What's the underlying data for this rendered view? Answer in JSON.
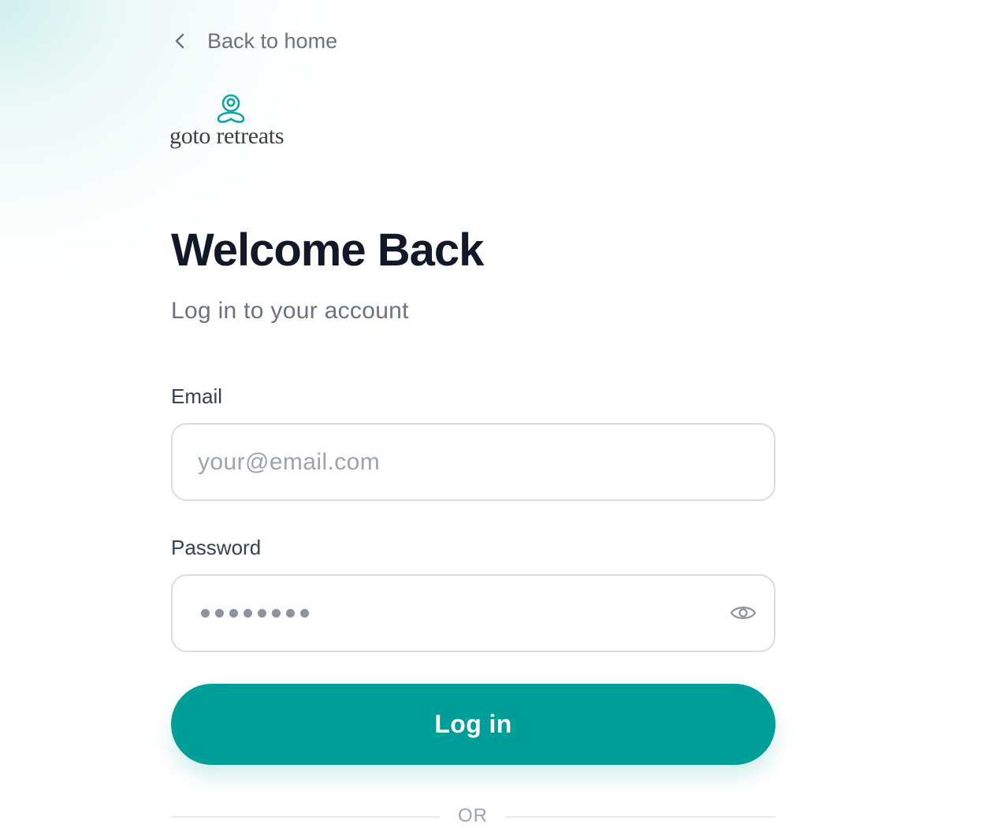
{
  "nav": {
    "back_label": "Back to home"
  },
  "brand": {
    "wordmark": "goto retreats",
    "accent_color": "#009e99"
  },
  "heading": {
    "title": "Welcome Back",
    "subtitle": "Log in to your account"
  },
  "form": {
    "email": {
      "label": "Email",
      "placeholder": "your@email.com",
      "value": ""
    },
    "password": {
      "label": "Password",
      "masked_length": 8,
      "visibility_icon": "eye-icon"
    },
    "submit_label": "Log in",
    "divider_label": "OR"
  }
}
